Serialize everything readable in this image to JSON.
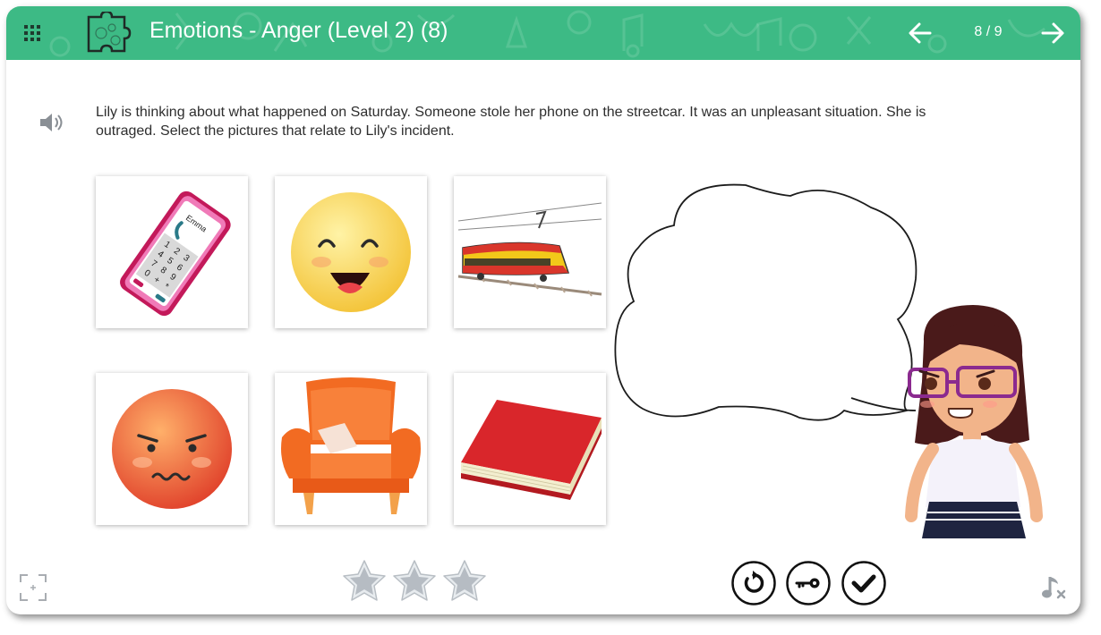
{
  "header": {
    "title": "Emotions - Anger (Level 2) (8)",
    "page_counter": "8 / 9",
    "menu_icon": "grid-menu-icon",
    "activity_icon": "puzzle-icon",
    "prev_icon": "arrow-left-icon",
    "next_icon": "arrow-right-icon",
    "color": "#3dba85"
  },
  "question": {
    "audio_icon": "speaker-icon",
    "text": "Lily is thinking about what happened on Saturday. Someone stole her phone on the streetcar. It was an unpleasant situation. She is outraged. Select the pictures that relate to Lily's incident."
  },
  "tiles": [
    {
      "name": "tile-phone",
      "phone_label": "Emma",
      "keys": [
        "1",
        "2",
        "3",
        "4",
        "5",
        "6",
        "7",
        "8",
        "9",
        "0",
        "+",
        "*"
      ]
    },
    {
      "name": "tile-happy-face"
    },
    {
      "name": "tile-streetcar"
    },
    {
      "name": "tile-angry-face"
    },
    {
      "name": "tile-armchair"
    },
    {
      "name": "tile-book"
    }
  ],
  "footer": {
    "fullscreen_icon": "fullscreen-icon",
    "stars_total": 3,
    "stars_earned": 0,
    "buttons": [
      {
        "name": "retry-button",
        "icon": "retry-icon"
      },
      {
        "name": "answer-key-button",
        "icon": "key-icon"
      },
      {
        "name": "check-button",
        "icon": "checkmark-icon"
      }
    ],
    "music_icon": "music-off-icon"
  }
}
